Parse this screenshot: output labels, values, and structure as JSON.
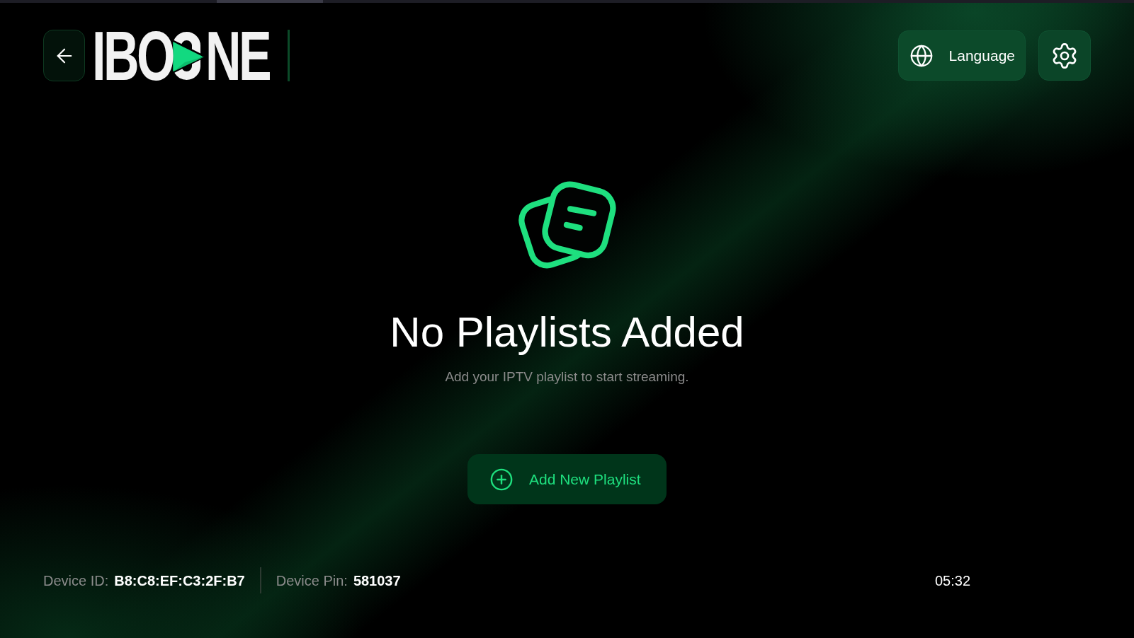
{
  "header": {
    "logo": {
      "text_before_mark": "IBO",
      "text_after_mark": "NE"
    },
    "language_button": {
      "label": "Language"
    }
  },
  "empty_state": {
    "title": "No Playlists Added",
    "message": "Add your IPTV playlist to start streaming.",
    "action_button": {
      "label": "Add New Playlist"
    }
  },
  "footer": {
    "device_info": [
      {
        "label": "Device ID:",
        "value": "B8:C8:EF:C3:2F:B7"
      },
      {
        "label": "Device Pin:",
        "value": "581037"
      }
    ],
    "time": "05:32"
  }
}
